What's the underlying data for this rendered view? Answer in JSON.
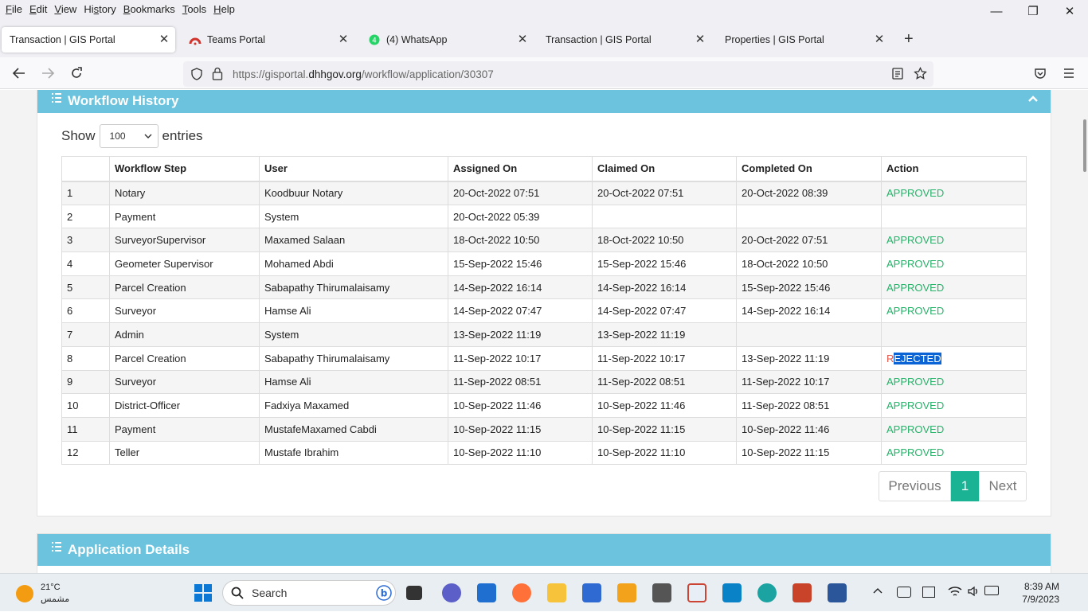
{
  "menu": [
    "File",
    "Edit",
    "View",
    "History",
    "Bookmarks",
    "Tools",
    "Help"
  ],
  "menu_keys": [
    "F",
    "E",
    "V",
    "s",
    "B",
    "T",
    "H"
  ],
  "tabs": [
    {
      "title": "Transaction | GIS Portal",
      "icon": "page-icon"
    },
    {
      "title": "Teams Portal",
      "icon": "teams-icon"
    },
    {
      "title": "(4) WhatsApp",
      "icon": "whatsapp-icon"
    },
    {
      "title": "Transaction | GIS Portal",
      "icon": "page-icon"
    },
    {
      "title": "Properties | GIS Portal",
      "icon": "page-icon"
    }
  ],
  "url": {
    "prefix": "https://gisportal.",
    "domain": "dhhgov.org",
    "suffix": "/workflow/application/30307"
  },
  "workflow": {
    "title": "Workflow History",
    "show_label": "Show",
    "entries_label": "entries",
    "page_size": "100",
    "columns": [
      "",
      "Workflow Step",
      "User",
      "Assigned On",
      "Claimed On",
      "Completed On",
      "Action"
    ],
    "rows": [
      {
        "n": "1",
        "step": "Notary",
        "user": "Koodbuur Notary",
        "assigned": "20-Oct-2022 07:51",
        "claimed": "20-Oct-2022 07:51",
        "completed": "20-Oct-2022 08:39",
        "action": "APPROVED"
      },
      {
        "n": "2",
        "step": "Payment",
        "user": "System",
        "assigned": "20-Oct-2022 05:39",
        "claimed": "",
        "completed": "",
        "action": ""
      },
      {
        "n": "3",
        "step": "SurveyorSupervisor",
        "user": "Maxamed Salaan",
        "assigned": "18-Oct-2022 10:50",
        "claimed": "18-Oct-2022 10:50",
        "completed": "20-Oct-2022 07:51",
        "action": "APPROVED"
      },
      {
        "n": "4",
        "step": "Geometer Supervisor",
        "user": "Mohamed Abdi",
        "assigned": "15-Sep-2022 15:46",
        "claimed": "15-Sep-2022 15:46",
        "completed": "18-Oct-2022 10:50",
        "action": "APPROVED"
      },
      {
        "n": "5",
        "step": "Parcel Creation",
        "user": "Sabapathy Thirumalaisamy",
        "assigned": "14-Sep-2022 16:14",
        "claimed": "14-Sep-2022 16:14",
        "completed": "15-Sep-2022 15:46",
        "action": "APPROVED"
      },
      {
        "n": "6",
        "step": "Surveyor",
        "user": "Hamse Ali",
        "assigned": "14-Sep-2022 07:47",
        "claimed": "14-Sep-2022 07:47",
        "completed": "14-Sep-2022 16:14",
        "action": "APPROVED"
      },
      {
        "n": "7",
        "step": "Admin",
        "user": "System",
        "assigned": "13-Sep-2022 11:19",
        "claimed": "13-Sep-2022 11:19",
        "completed": "",
        "action": ""
      },
      {
        "n": "8",
        "step": "Parcel Creation",
        "user": "Sabapathy Thirumalaisamy",
        "assigned": "11-Sep-2022 10:17",
        "claimed": "11-Sep-2022 10:17",
        "completed": "13-Sep-2022 11:19",
        "action": "REJECTED"
      },
      {
        "n": "9",
        "step": "Surveyor",
        "user": "Hamse Ali",
        "assigned": "11-Sep-2022 08:51",
        "claimed": "11-Sep-2022 08:51",
        "completed": "11-Sep-2022 10:17",
        "action": "APPROVED"
      },
      {
        "n": "10",
        "step": "District-Officer",
        "user": "Fadxiya Maxamed",
        "assigned": "10-Sep-2022 11:46",
        "claimed": "10-Sep-2022 11:46",
        "completed": "11-Sep-2022 08:51",
        "action": "APPROVED"
      },
      {
        "n": "11",
        "step": "Payment",
        "user": "MustafeMaxamed Cabdi",
        "assigned": "10-Sep-2022 11:15",
        "claimed": "10-Sep-2022 11:15",
        "completed": "10-Sep-2022 11:46",
        "action": "APPROVED"
      },
      {
        "n": "12",
        "step": "Teller",
        "user": "Mustafe Ibrahim",
        "assigned": "10-Sep-2022 11:10",
        "claimed": "10-Sep-2022 11:10",
        "completed": "10-Sep-2022 11:15",
        "action": "APPROVED"
      }
    ],
    "pager": {
      "prev": "Previous",
      "current": "1",
      "next": "Next"
    }
  },
  "details": {
    "title": "Application Details"
  },
  "colors": {
    "header": "#6bc3de",
    "approved": "#27b26a",
    "rejected": "#e05a4a",
    "pager_active": "#1ab394"
  },
  "taskbar": {
    "weather_temp": "21°C",
    "weather_desc": "مشمس",
    "search_placeholder": "Search",
    "time": "8:39 AM",
    "date": "7/9/2023"
  }
}
